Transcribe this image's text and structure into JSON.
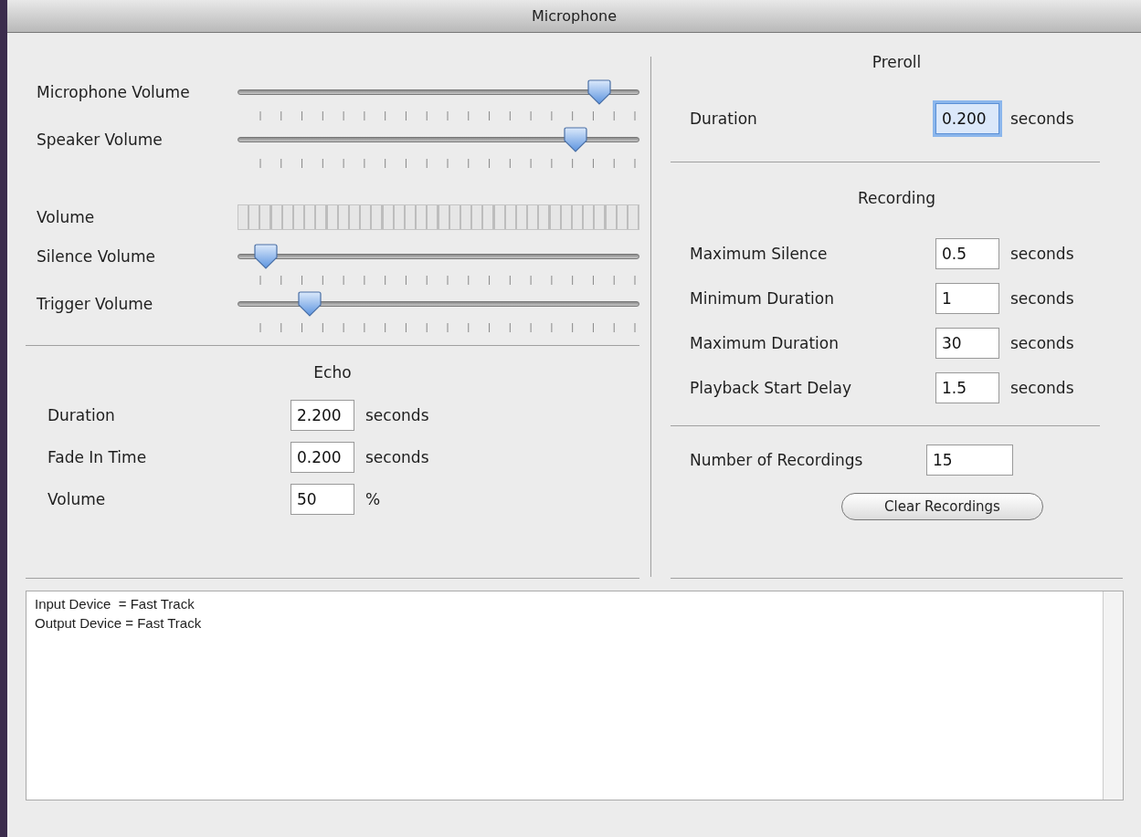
{
  "window": {
    "title": "Microphone"
  },
  "levels": [
    {
      "kind": "slider",
      "label": "Microphone Volume",
      "level": 0.9
    },
    {
      "kind": "slider",
      "label": "Speaker Volume",
      "level": 0.84
    },
    {
      "kind": "meter",
      "label": "Volume",
      "level": 0
    },
    {
      "kind": "slider",
      "label": "Silence Volume",
      "level": 0.07
    },
    {
      "kind": "slider",
      "label": "Trigger Volume",
      "level": 0.18
    }
  ],
  "echo": {
    "title": "Echo",
    "fields": [
      {
        "label": "Duration",
        "value": "2.200",
        "unit": "seconds"
      },
      {
        "label": "Fade In Time",
        "value": "0.200",
        "unit": "seconds"
      },
      {
        "label": "Volume",
        "value": "50",
        "unit": "%"
      }
    ]
  },
  "preroll": {
    "title": "Preroll",
    "fields": [
      {
        "label": "Duration",
        "value": "0.200",
        "unit": "seconds",
        "focused": true
      }
    ]
  },
  "recording": {
    "title": "Recording",
    "fields": [
      {
        "label": "Maximum Silence",
        "value": "0.5",
        "unit": "seconds",
        "focused": false
      },
      {
        "label": "Minimum Duration",
        "value": "1",
        "unit": "seconds",
        "focused": false
      },
      {
        "label": "Maximum Duration",
        "value": "30",
        "unit": "seconds",
        "focused": false
      },
      {
        "label": "Playback Start Delay",
        "value": "1.5",
        "unit": "seconds",
        "focused": false
      }
    ]
  },
  "number_of_recordings": {
    "label": "Number of Recordings",
    "value": "15"
  },
  "clear_button": "Clear Recordings",
  "log": [
    "Input Device  = Fast Track",
    "Output Device = Fast Track"
  ]
}
